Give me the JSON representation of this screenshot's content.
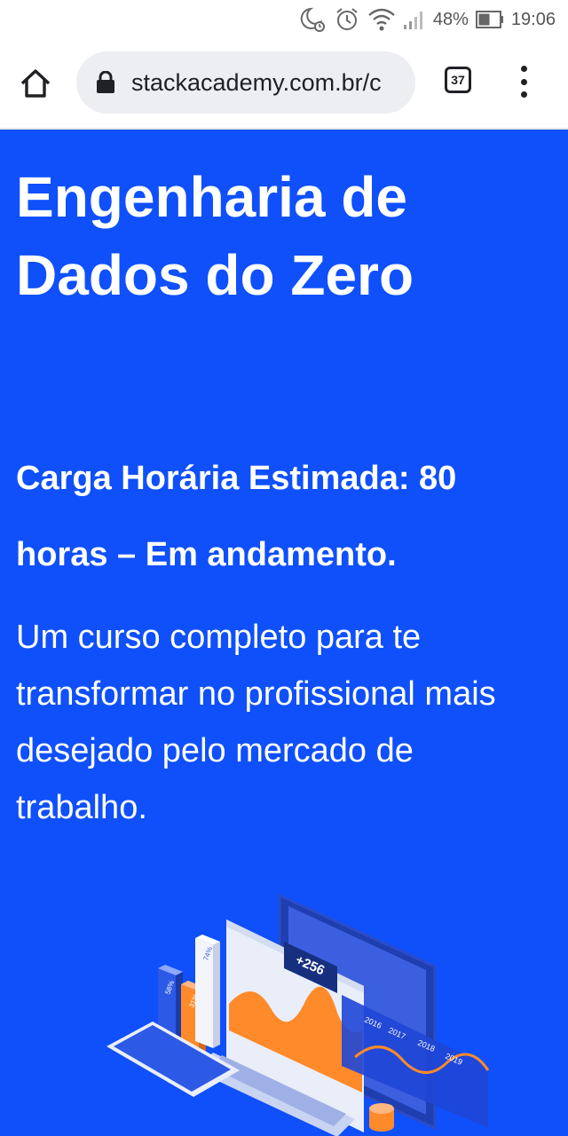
{
  "status_bar": {
    "battery_percent": "48%",
    "time": "19:06",
    "icons": [
      "moon-alarm-icon",
      "alarm-clock-icon",
      "wifi-icon",
      "signal-icon",
      "battery-icon"
    ]
  },
  "browser": {
    "url": "stackacademy.com.br/c",
    "tab_count": "37",
    "icons": [
      "home-icon",
      "lock-icon",
      "tabs-icon",
      "more-vert-icon"
    ]
  },
  "page": {
    "background_color": "#0f50fb",
    "title": "Engenharia de Dados do Zero",
    "subtitle": "Carga Horária Estimada: 80 horas – Em andamento.",
    "description": "Um curso completo para te transformar no profissional mais desejado pelo mercado de trabalho.",
    "illustration": {
      "bar_labels": [
        "58%",
        "31%",
        "74%"
      ],
      "badge": "+256",
      "years": [
        "2016",
        "2017",
        "2018",
        "2019"
      ]
    }
  }
}
